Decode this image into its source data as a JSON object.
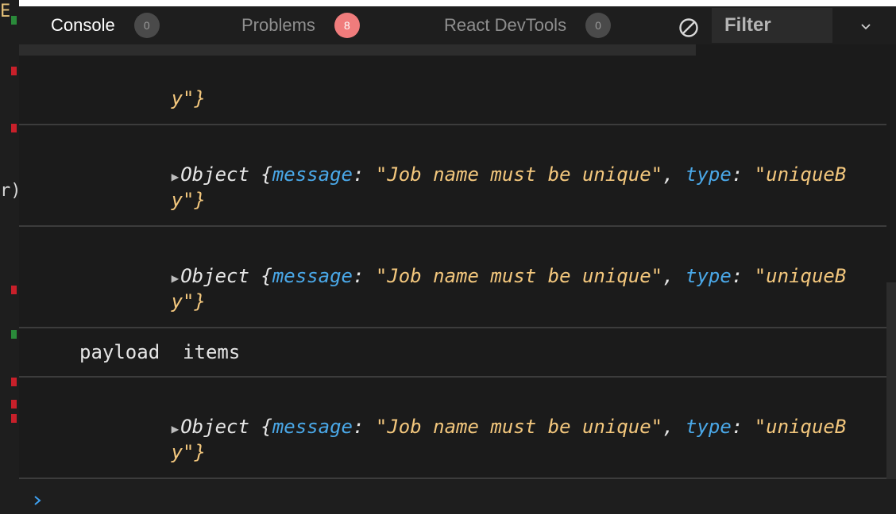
{
  "gutter": {
    "top_char": "E",
    "mid_char": "r)"
  },
  "tabs": [
    {
      "label": "Console",
      "count": "0",
      "active": true
    },
    {
      "label": "Problems",
      "count": "8",
      "active": false
    },
    {
      "label": "React DevTools",
      "count": "0",
      "active": false
    }
  ],
  "filter": {
    "placeholder": "Filter"
  },
  "icons": {
    "clear": "clear-console-icon",
    "chevron": "chevron-down-icon",
    "prompt": "chevron-right-icon",
    "expand": "triangle-right-icon"
  },
  "colors": {
    "key": "#4aa8e8",
    "string": "#f3c77d",
    "badge_alert": "#f07c7c"
  },
  "log": {
    "partial": {
      "tail": "y\"}"
    },
    "entries": [
      {
        "prefix": "Object {",
        "key1": "message",
        "val1": "\"Job name must be unique\"",
        "key2": "type",
        "val2": "\"uniqueB",
        "tail": "y\"}"
      },
      {
        "prefix": "Object {",
        "key1": "message",
        "val1": "\"Job name must be unique\"",
        "key2": "type",
        "val2": "\"uniqueB",
        "tail": "y\"}"
      },
      {
        "text": "payload  items"
      },
      {
        "prefix": "Object {",
        "key1": "message",
        "val1": "\"Job name must be unique\"",
        "key2": "type",
        "val2": "\"uniqueB",
        "tail": "y\"}"
      }
    ]
  }
}
